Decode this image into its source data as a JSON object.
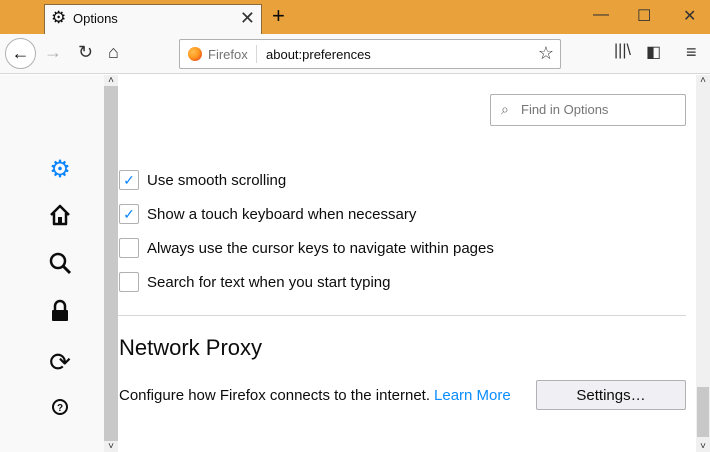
{
  "window": {
    "tab_title": "Options",
    "tab_icon": "gear-icon",
    "new_tab": "+",
    "minimize": "—",
    "maximize": "☐",
    "close": "✕"
  },
  "navbar": {
    "identity_label": "Firefox",
    "url": "about:preferences"
  },
  "sidebar": {
    "categories": [
      "gear-icon",
      "home-icon",
      "search-icon",
      "lock-icon",
      "sync-icon",
      "help-icon"
    ]
  },
  "search": {
    "placeholder": "Find in Options"
  },
  "browsing": {
    "items": [
      {
        "label": "Use smooth scrolling",
        "checked": true
      },
      {
        "label": "Show a touch keyboard when necessary",
        "checked": true
      },
      {
        "label": "Always use the cursor keys to navigate within pages",
        "checked": false
      },
      {
        "label": "Search for text when you start typing",
        "checked": false
      }
    ]
  },
  "network_proxy": {
    "title": "Network Proxy",
    "description": "Configure how Firefox connects to the internet.",
    "learn_more": "Learn More",
    "settings_button": "Settings…"
  },
  "colors": {
    "titlebar": "#e9a23b",
    "accent": "#0a84ff",
    "link": "#0a8dff"
  }
}
